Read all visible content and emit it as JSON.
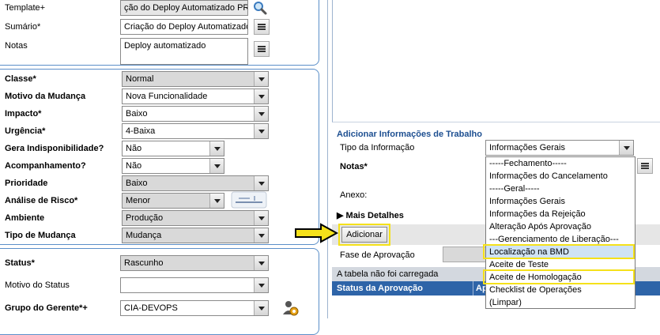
{
  "left_top": {
    "template_label": "Template+",
    "template_value": "ção do Deploy Automatizado PRD",
    "summary_label": "Sumário*",
    "summary_value": "Criação do Deploy Automatizado",
    "notes_label": "Notas",
    "notes_value": "Deploy automatizado"
  },
  "classification": {
    "class_label": "Classe*",
    "class_value": "Normal",
    "reason_label": "Motivo da Mudança",
    "reason_value": "Nova Funcionalidade",
    "impact_label": "Impacto*",
    "impact_value": "Baixo",
    "urgency_label": "Urgência*",
    "urgency_value": "4-Baixa",
    "unavail_label": "Gera Indisponibilidade?",
    "unavail_value": "Não",
    "follow_label": "Acompanhamento?",
    "follow_value": "Não",
    "priority_label": "Prioridade",
    "priority_value": "Baixo",
    "risk_label": "Análise de Risco*",
    "risk_value": "Menor",
    "env_label": "Ambiente",
    "env_value": "Produção",
    "type_label": "Tipo de Mudança",
    "type_value": "Mudança"
  },
  "status": {
    "status_label": "Status*",
    "status_value": "Rascunho",
    "reason_label": "Motivo do Status",
    "reason_value": "",
    "manager_label": "Grupo do Gerente*+",
    "manager_value": "CIA-DEVOPS"
  },
  "work_info": {
    "title": "Adicionar Informações de Trabalho",
    "type_label": "Tipo da Informação",
    "type_value": "Informações Gerais",
    "notes_label": "Notas*",
    "attach_label": "Anexo:",
    "more_details": "Mais Detalhes",
    "add_button": "Adicionar",
    "approval_phase_label": "Fase de Aprovação",
    "table_not_loaded": "A tabela não foi carregada",
    "col_status": "Status da Aprovação",
    "col_second": "Ap"
  },
  "dropdown_options": [
    "-----Fechamento-----",
    "Informações do Cancelamento",
    "-----Geral-----",
    "Informações Gerais",
    "Informações da Rejeição",
    "Alteração Após Aprovação",
    "---Gerenciamento de Liberação---",
    "Localização na BMD",
    "Aceite de Teste",
    "Aceite de Homologação",
    "Checklist de Operações",
    "(Limpar)"
  ],
  "selected_option_index": 7,
  "highlight_color": "#f5e11a"
}
